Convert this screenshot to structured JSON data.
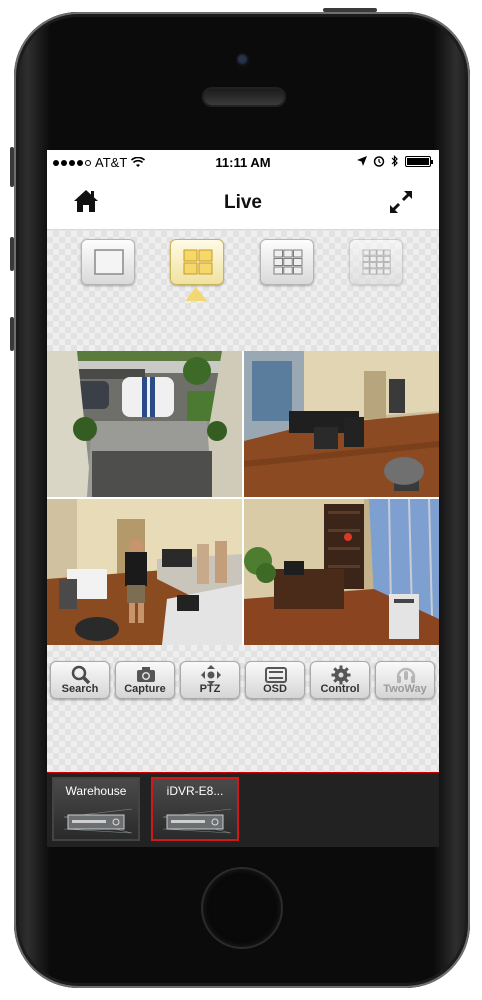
{
  "status_bar": {
    "carrier": "AT&T",
    "time": "11:11 AM"
  },
  "nav": {
    "title": "Live"
  },
  "layouts": [
    {
      "name": "single",
      "active": false
    },
    {
      "name": "quad",
      "active": true
    },
    {
      "name": "nine",
      "active": false
    },
    {
      "name": "sixteen",
      "active": false
    }
  ],
  "cameras": [
    {
      "scene": "parking lot"
    },
    {
      "scene": "office"
    },
    {
      "scene": "office with person"
    },
    {
      "scene": "office with window"
    }
  ],
  "toolbar": {
    "search": "Search",
    "capture": "Capture",
    "ptz": "PTZ",
    "osd": "OSD",
    "control": "Control",
    "twoway": "TwoWay"
  },
  "devices": [
    {
      "name": "Warehouse",
      "selected": false
    },
    {
      "name": "iDVR-E8...",
      "selected": true
    }
  ],
  "colors": {
    "selected_border": "#d01818",
    "active_layout": "#f2d873"
  }
}
